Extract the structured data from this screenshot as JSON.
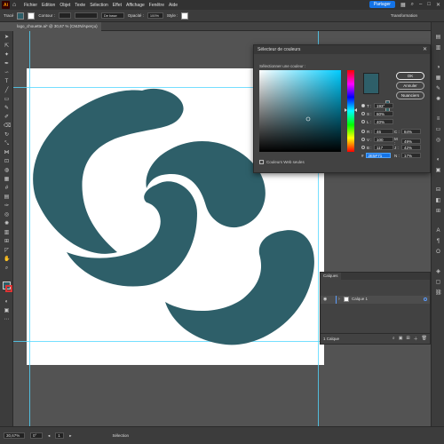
{
  "menubar": {
    "items": [
      "Fichier",
      "Edition",
      "Objet",
      "Texte",
      "Sélection",
      "Effet",
      "Affichage",
      "Fenêtre",
      "Aide"
    ],
    "share_label": "Partager"
  },
  "control": {
    "selection_label": "Tracé",
    "fill_color": "#2E5F69",
    "stroke_label": "Contour :",
    "brush_label": "De base",
    "opacity_label": "Opacité :",
    "opacity_value": "100%",
    "style_label": "Style :",
    "transform_label": "Transformation"
  },
  "tab": {
    "label": "logo_chouette.ai* @ 30,67 % (CMJN/Aperçu)"
  },
  "artwork": {
    "color": "#2E5F69"
  },
  "color_picker": {
    "title": "Sélecteur de couleurs",
    "select_label": "Sélectionner une couleur :",
    "preview_color": "#2E5F69",
    "ok_label": "OK",
    "cancel_label": "Annuler",
    "swatches_label": "Nuanciers",
    "hsb": {
      "h_label": "T :",
      "h": "193°",
      "s_label": "S :",
      "s": "60%",
      "b_label": "L :",
      "b": "40%"
    },
    "rgb": {
      "r_label": "R :",
      "r": "46",
      "g_label": "V :",
      "g": "100",
      "b_label": "B :",
      "b": "117"
    },
    "hex": "2E5F71",
    "cmyk": {
      "c_label": "C :",
      "c": "84%",
      "m_label": "M :",
      "m": "49%",
      "y_label": "J :",
      "y": "42%",
      "k_label": "N :",
      "k": "17%"
    },
    "web_only_label": "Couleurs Web seules"
  },
  "layers": {
    "tab_label": "Calques",
    "layer_name": "Calque 1",
    "footer_count": "1 Calque"
  },
  "status": {
    "zoom": "30,67%",
    "page": "1",
    "angle": "0°",
    "selection_label": "Sélection"
  }
}
